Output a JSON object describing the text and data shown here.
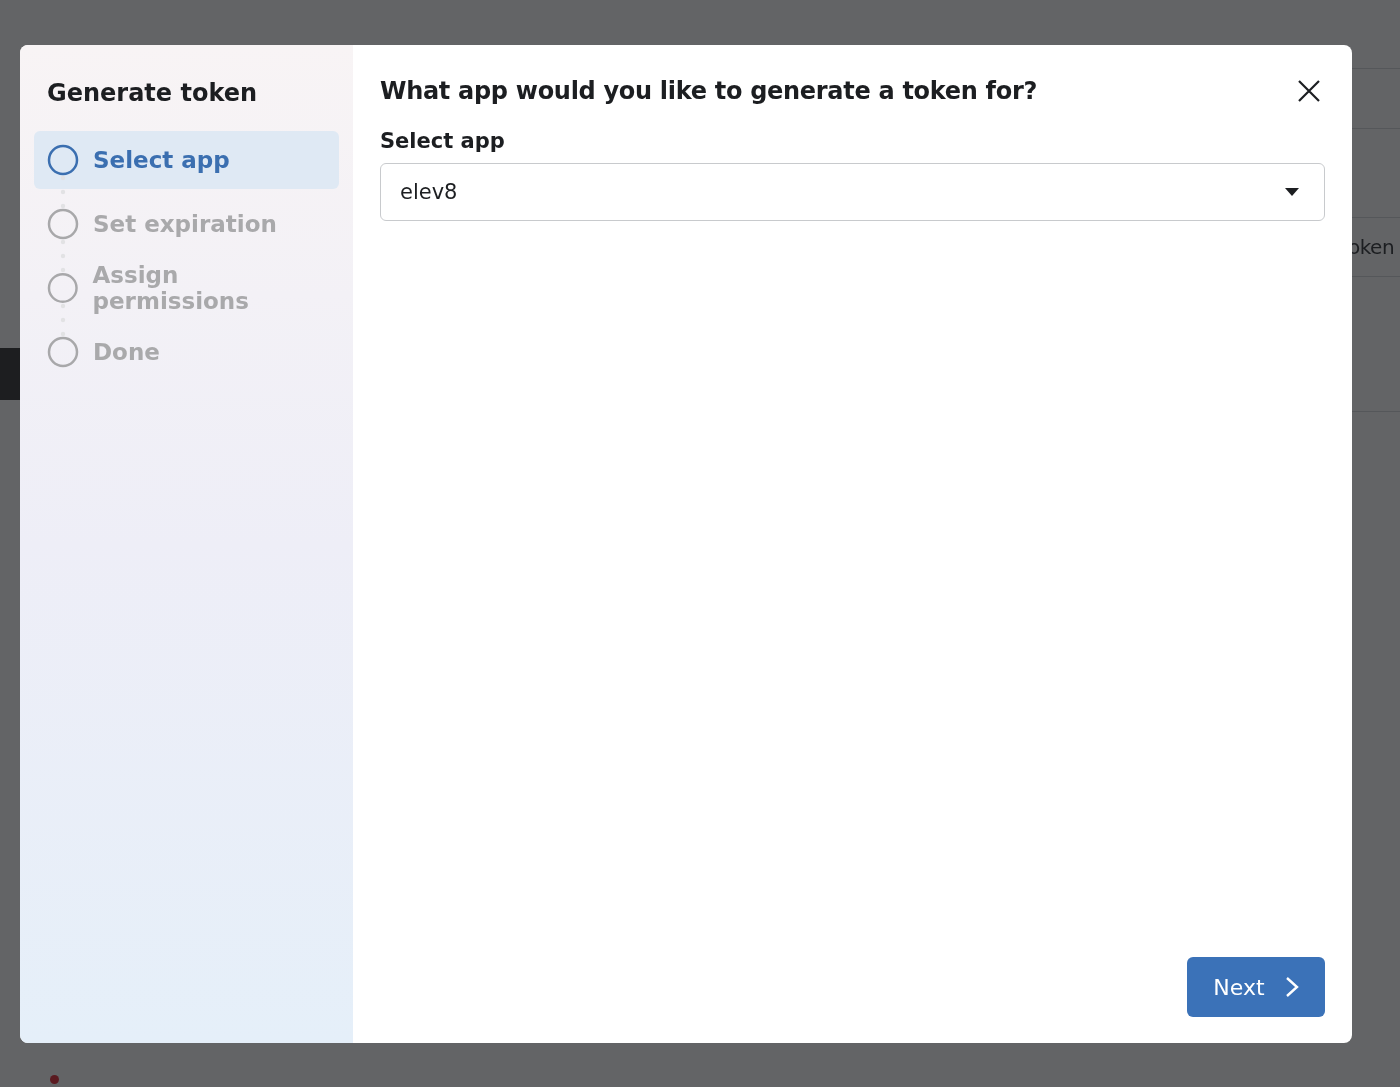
{
  "background": {
    "cut_text": "oken"
  },
  "dialog": {
    "sidebar_title": "Generate token",
    "steps": [
      {
        "label": "Select app",
        "selected": true
      },
      {
        "label": "Set expiration",
        "selected": false
      },
      {
        "label": "Assign permissions",
        "selected": false
      },
      {
        "label": "Done",
        "selected": false
      }
    ],
    "heading": "What app would you like to generate a token for?",
    "field_label": "Select app",
    "select_value": "elev8",
    "next_button": "Next"
  }
}
